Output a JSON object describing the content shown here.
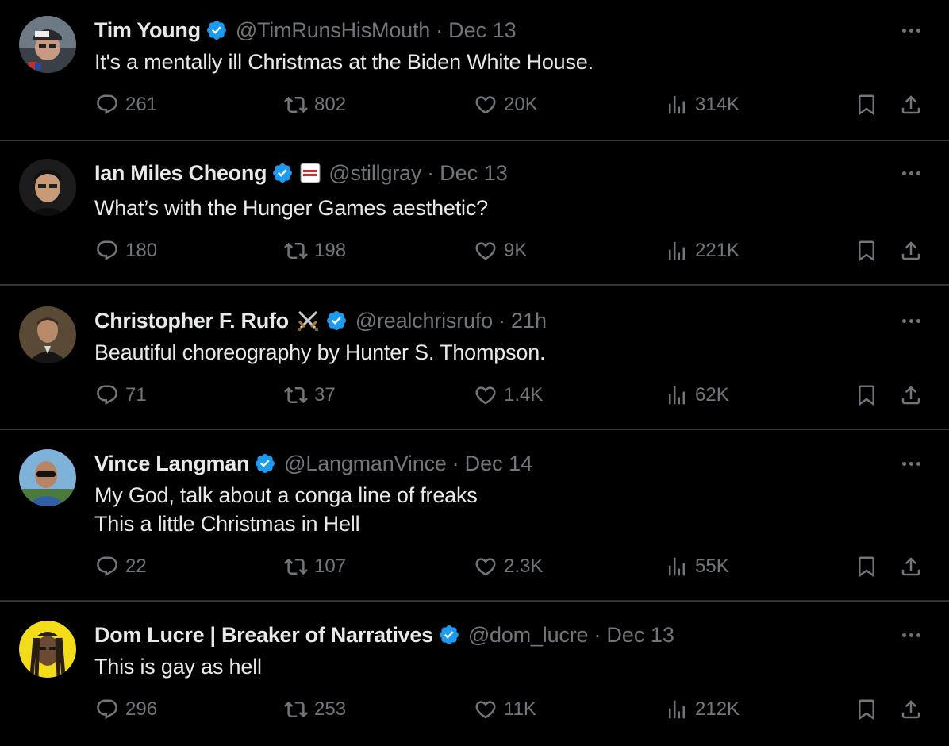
{
  "tweets": [
    {
      "name": "Tim Young",
      "handle": "@TimRunsHisMouth",
      "time": "Dec 13",
      "text_lines": [
        "It's a mentally ill Christmas at the Biden White House."
      ],
      "replies": "261",
      "retweets": "802",
      "likes": "20K",
      "views": "314K",
      "extra_emoji": ""
    },
    {
      "name": "Ian Miles Cheong",
      "handle": "@stillgray",
      "time": "Dec 13",
      "text_lines": [
        "What’s with the Hunger Games aesthetic?"
      ],
      "replies": "180",
      "retweets": "198",
      "likes": "9K",
      "views": "221K",
      "extra_emoji": "affiliate-badge-icon"
    },
    {
      "name": "Christopher F. Rufo",
      "handle": "@realchrisrufo",
      "time": "21h",
      "text_lines": [
        "Beautiful choreography by Hunter S. Thompson."
      ],
      "replies": "71",
      "retweets": "37",
      "likes": "1.4K",
      "views": "62K",
      "extra_emoji": "crossed-swords-icon"
    },
    {
      "name": "Vince Langman",
      "handle": "@LangmanVince",
      "time": "Dec 14",
      "text_lines": [
        "My God, talk about a conga line of freaks",
        "This a little Christmas in Hell"
      ],
      "replies": "22",
      "retweets": "107",
      "likes": "2.3K",
      "views": "55K",
      "extra_emoji": ""
    },
    {
      "name": "Dom Lucre | Breaker of Narratives",
      "handle": "@dom_lucre",
      "time": "Dec 13",
      "text_lines": [
        "This is gay as hell"
      ],
      "replies": "296",
      "retweets": "253",
      "likes": "11K",
      "views": "212K",
      "extra_emoji": ""
    }
  ],
  "colors": {
    "background": "#000000",
    "text": "#e7e9ea",
    "muted": "#71767b",
    "divider": "#2f3336",
    "verified": "#1d9bf0"
  },
  "separator": "·",
  "icons": {
    "reply": "reply-icon",
    "retweet": "retweet-icon",
    "like": "heart-icon",
    "views": "views-icon",
    "bookmark": "bookmark-icon",
    "share": "share-icon",
    "more": "more-icon",
    "verified": "verified-badge-icon"
  }
}
